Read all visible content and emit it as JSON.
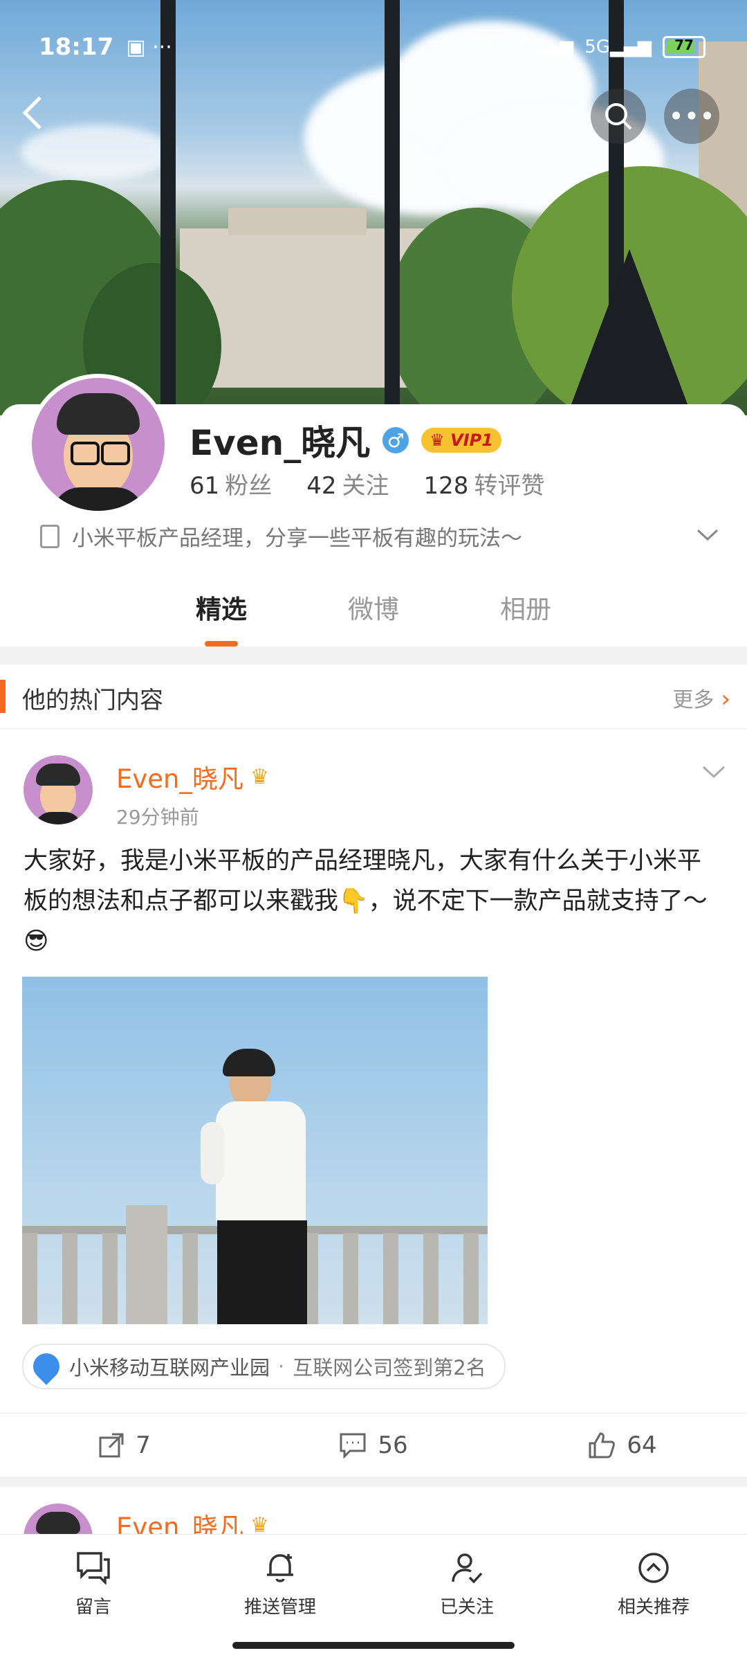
{
  "status_bar": {
    "time": "18:17",
    "network1": "5G",
    "network2": "5G",
    "battery": "77"
  },
  "header": {
    "back_icon": "chevron-left-icon",
    "search_icon": "search-icon",
    "more_icon": "more-dots-icon"
  },
  "profile": {
    "name": "Even_晓凡",
    "gender_symbol": "♂",
    "vip_label": "VIP1",
    "stats": [
      {
        "value": "61",
        "label": "粉丝"
      },
      {
        "value": "42",
        "label": "关注"
      },
      {
        "value": "128",
        "label": "转评赞"
      }
    ],
    "bio": "小米平板产品经理，分享一些平板有趣的玩法～"
  },
  "tabs": [
    {
      "label": "精选",
      "active": true
    },
    {
      "label": "微博"
    },
    {
      "label": "相册"
    }
  ],
  "hot_section": {
    "title": "他的热门内容",
    "more_label": "更多"
  },
  "post": {
    "author": "Even_晓凡",
    "time": "29分钟前",
    "text": "大家好，我是小米平板的产品经理晓凡，大家有什么关于小米平板的想法和点子都可以来戳我👇，说不定下一款产品就支持了～😎",
    "location": "小米移动互联网产业园",
    "location_sub": "互联网公司签到第2名",
    "reposts": "7",
    "comments": "56",
    "likes": "64"
  },
  "post2": {
    "author": "Even_晓凡"
  },
  "bottom_nav": [
    {
      "label": "留言",
      "icon": "message-icon"
    },
    {
      "label": "推送管理",
      "icon": "bell-icon"
    },
    {
      "label": "已关注",
      "icon": "user-check-icon"
    },
    {
      "label": "相关推荐",
      "icon": "arrow-up-circle-icon"
    }
  ],
  "colors": {
    "accent": "#f36b1d",
    "link_blue": "#3c8fe8",
    "vip_gold": "#f7c12f"
  }
}
